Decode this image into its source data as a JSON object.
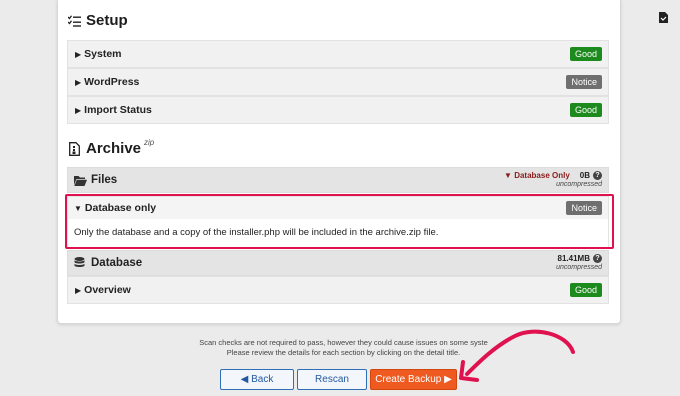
{
  "setup": {
    "title": "Setup",
    "rows": [
      {
        "label": "System",
        "status": "Good",
        "status_kind": "good"
      },
      {
        "label": "WordPress",
        "status": "Notice",
        "status_kind": "notice"
      },
      {
        "label": "Import Status",
        "status": "Good",
        "status_kind": "good"
      }
    ]
  },
  "archive": {
    "title": "Archive",
    "format": "zip",
    "files": {
      "label": "Files",
      "filter": "Database Only",
      "size": "0B",
      "size_note": "uncompressed",
      "help": "?"
    },
    "database_only": {
      "label": "Database only",
      "status": "Notice",
      "description": "Only the database and a copy of the installer.php will be included in the archive.zip file."
    },
    "database": {
      "label": "Database",
      "size": "81.41MB",
      "size_note": "uncompressed",
      "help": "?"
    },
    "overview": {
      "label": "Overview",
      "status": "Good"
    }
  },
  "footer": {
    "line1": "Scan checks are not required to pass, however they could cause issues on some syste",
    "line2": "Please review the details for each section by clicking on the detail title."
  },
  "buttons": {
    "back": "◀ Back",
    "rescan": "Rescan",
    "create": "Create Backup ▶"
  },
  "colors": {
    "good": "#1d8a1d",
    "notice": "#6f6f6f",
    "highlight": "#e0114f",
    "annotation_arrow": "#e0114f",
    "primary_button": "#ee5a1f"
  }
}
